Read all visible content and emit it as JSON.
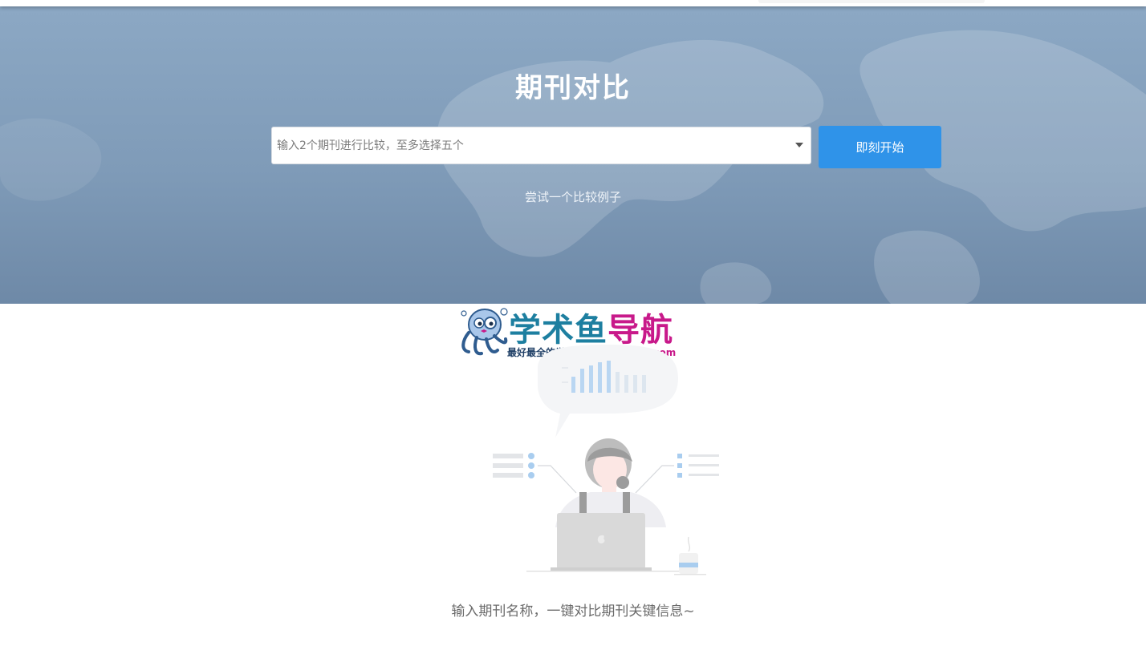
{
  "hero": {
    "title": "期刊对比",
    "search_placeholder": "输入2个期刊进行比较，至多选择五个",
    "start_button": "即刻开始",
    "try_example_link": "尝试一个比较例子"
  },
  "watermark": {
    "title_part1": "学术鱼",
    "title_part2": "导航",
    "subtitle": "最好最全的学术导航:",
    "url": "xueshuyu.com"
  },
  "empty_state": {
    "message": "输入期刊名称，一键对比期刊关键信息~"
  },
  "colors": {
    "hero_background": "#8ca8c4",
    "primary_button": "#2f93e9",
    "watermark_teal": "#1d7fa0",
    "watermark_magenta": "#c8198a"
  }
}
